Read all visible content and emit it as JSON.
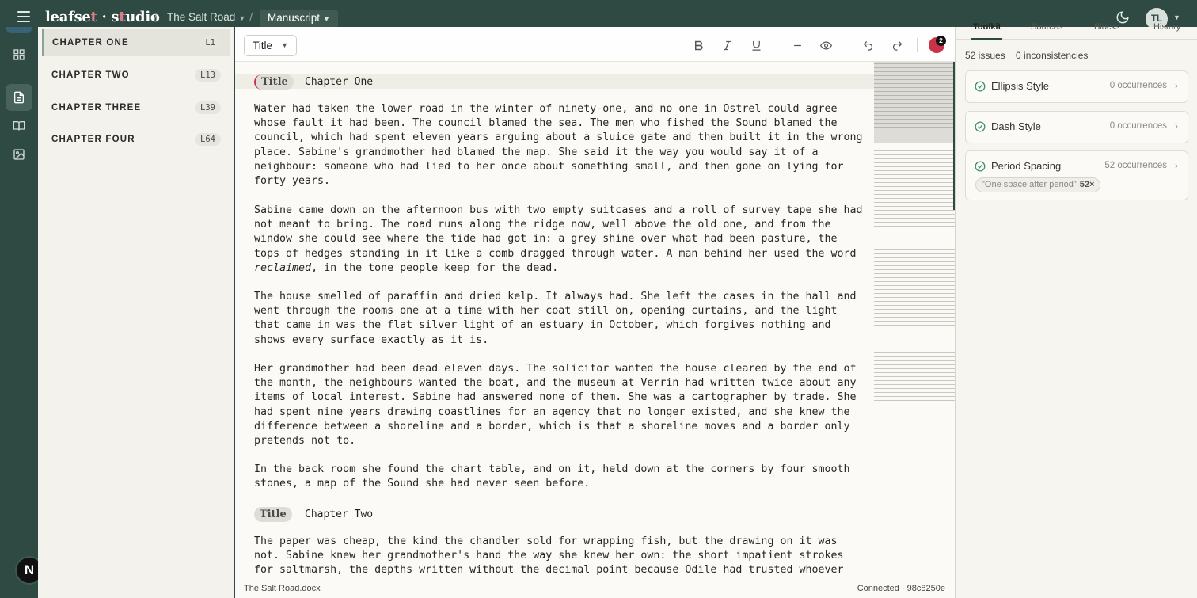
{
  "app": {
    "logo_main": "leafse",
    "logo_accent": "t",
    "logo_dot": " · ",
    "logo_studio_a": "s",
    "logo_studio_accent": "t",
    "logo_studio_b": "udio"
  },
  "breadcrumb": {
    "separator": "/",
    "project": "The Salt Road",
    "current": "Manuscript"
  },
  "user": {
    "initials": "TL"
  },
  "chapters": [
    {
      "label": "CHAPTER ONE",
      "line": "L1"
    },
    {
      "label": "CHAPTER TWO",
      "line": "L13"
    },
    {
      "label": "CHAPTER THREE",
      "line": "L39"
    },
    {
      "label": "CHAPTER FOUR",
      "line": "L64"
    }
  ],
  "toolbar": {
    "block_type": "Title",
    "collaborators_count": "2"
  },
  "document": {
    "title_tag": "Title",
    "sections": [
      {
        "title": "Chapter One",
        "paragraphs": [
          "Water had taken the lower road in the winter of ninety-one, and no one in Ostrel could agree\nwhose fault it had been. The council blamed the sea. The men who fished the Sound blamed the\ncouncil, which had spent eleven years arguing about a sluice gate and then built it in the wrong\nplace. Sabine's grandmother had blamed the map. She said it the way you would say it of a\nneighbour: someone who had lied to her once about something small, and then gone on lying for\nforty years.",
          "Sabine came down on the afternoon bus with two empty suitcases and a roll of survey tape she had\nnot meant to bring. The road runs along the ridge now, well above the old one, and from the\nwindow she could see where the tide had got in: a grey shine over what had been pasture, the\ntops of hedges standing in it like a comb dragged through water. A man behind her used the word",
          "The house smelled of paraffin and dried kelp. It always had. She left the cases in the hall and\nwent through the rooms one at a time with her coat still on, opening curtains, and the light\nthat came in was the flat silver light of an estuary in October, which forgives nothing and\nshows every surface exactly as it is.",
          "Her grandmother had been dead eleven days. The solicitor wanted the house cleared by the end of\nthe month, the neighbours wanted the boat, and the museum at Verrin had written twice about any\nitems of local interest. Sabine had answered none of them. She was a cartographer by trade. She\nhad spent nine years drawing coastlines for an agency that no longer existed, and she knew the\ndifference between a shoreline and a border, which is that a shoreline moves and a border only\npretends not to.",
          "In the back room she found the chart table, and on it, held down at the corners by four smooth\nstones, a map of the Sound she had never seen before."
        ],
        "italic_word": "reclaimed",
        "italic_tail": ", in the tone people keep for the dead."
      },
      {
        "title": "Chapter Two",
        "paragraphs": [
          "The paper was cheap, the kind the chandler sold for wrapping fish, but the drawing on it was\nnot. Sabine knew her grandmother's hand the way she knew her own: the short impatient strokes\nfor saltmarsh, the depths written without the decimal point because Odile had trusted whoever"
        ]
      }
    ]
  },
  "status": {
    "file": "The Salt Road.docx",
    "connection": "Connected · 98c8250e"
  },
  "panel": {
    "tabs": [
      "Toolkit",
      "Sources",
      "Blocks",
      "History"
    ],
    "issues": "52 issues",
    "inconsistencies": "0 inconsistencies",
    "rules": [
      {
        "name": "Ellipsis Style",
        "count": "0 occurrences"
      },
      {
        "name": "Dash Style",
        "count": "0 occurrences"
      },
      {
        "name": "Period Spacing",
        "count": "52 occurrences",
        "tag": "\"One space after period\"",
        "tag_count": "52×"
      }
    ]
  },
  "colors": {
    "brand": "#2f4a42",
    "accent": "#e07a86",
    "collaborator": "#c8334a",
    "check": "#3f8f6a"
  },
  "icons": {
    "menu": "hamburger-icon",
    "theme": "moon-icon",
    "rail": [
      "dashboard-icon",
      "document-icon",
      "book-icon",
      "image-icon"
    ],
    "toolbar": [
      "bold-icon",
      "italic-icon",
      "underline-icon",
      "horizontal-rule-icon",
      "preview-eye-icon",
      "undo-icon",
      "redo-icon"
    ]
  }
}
